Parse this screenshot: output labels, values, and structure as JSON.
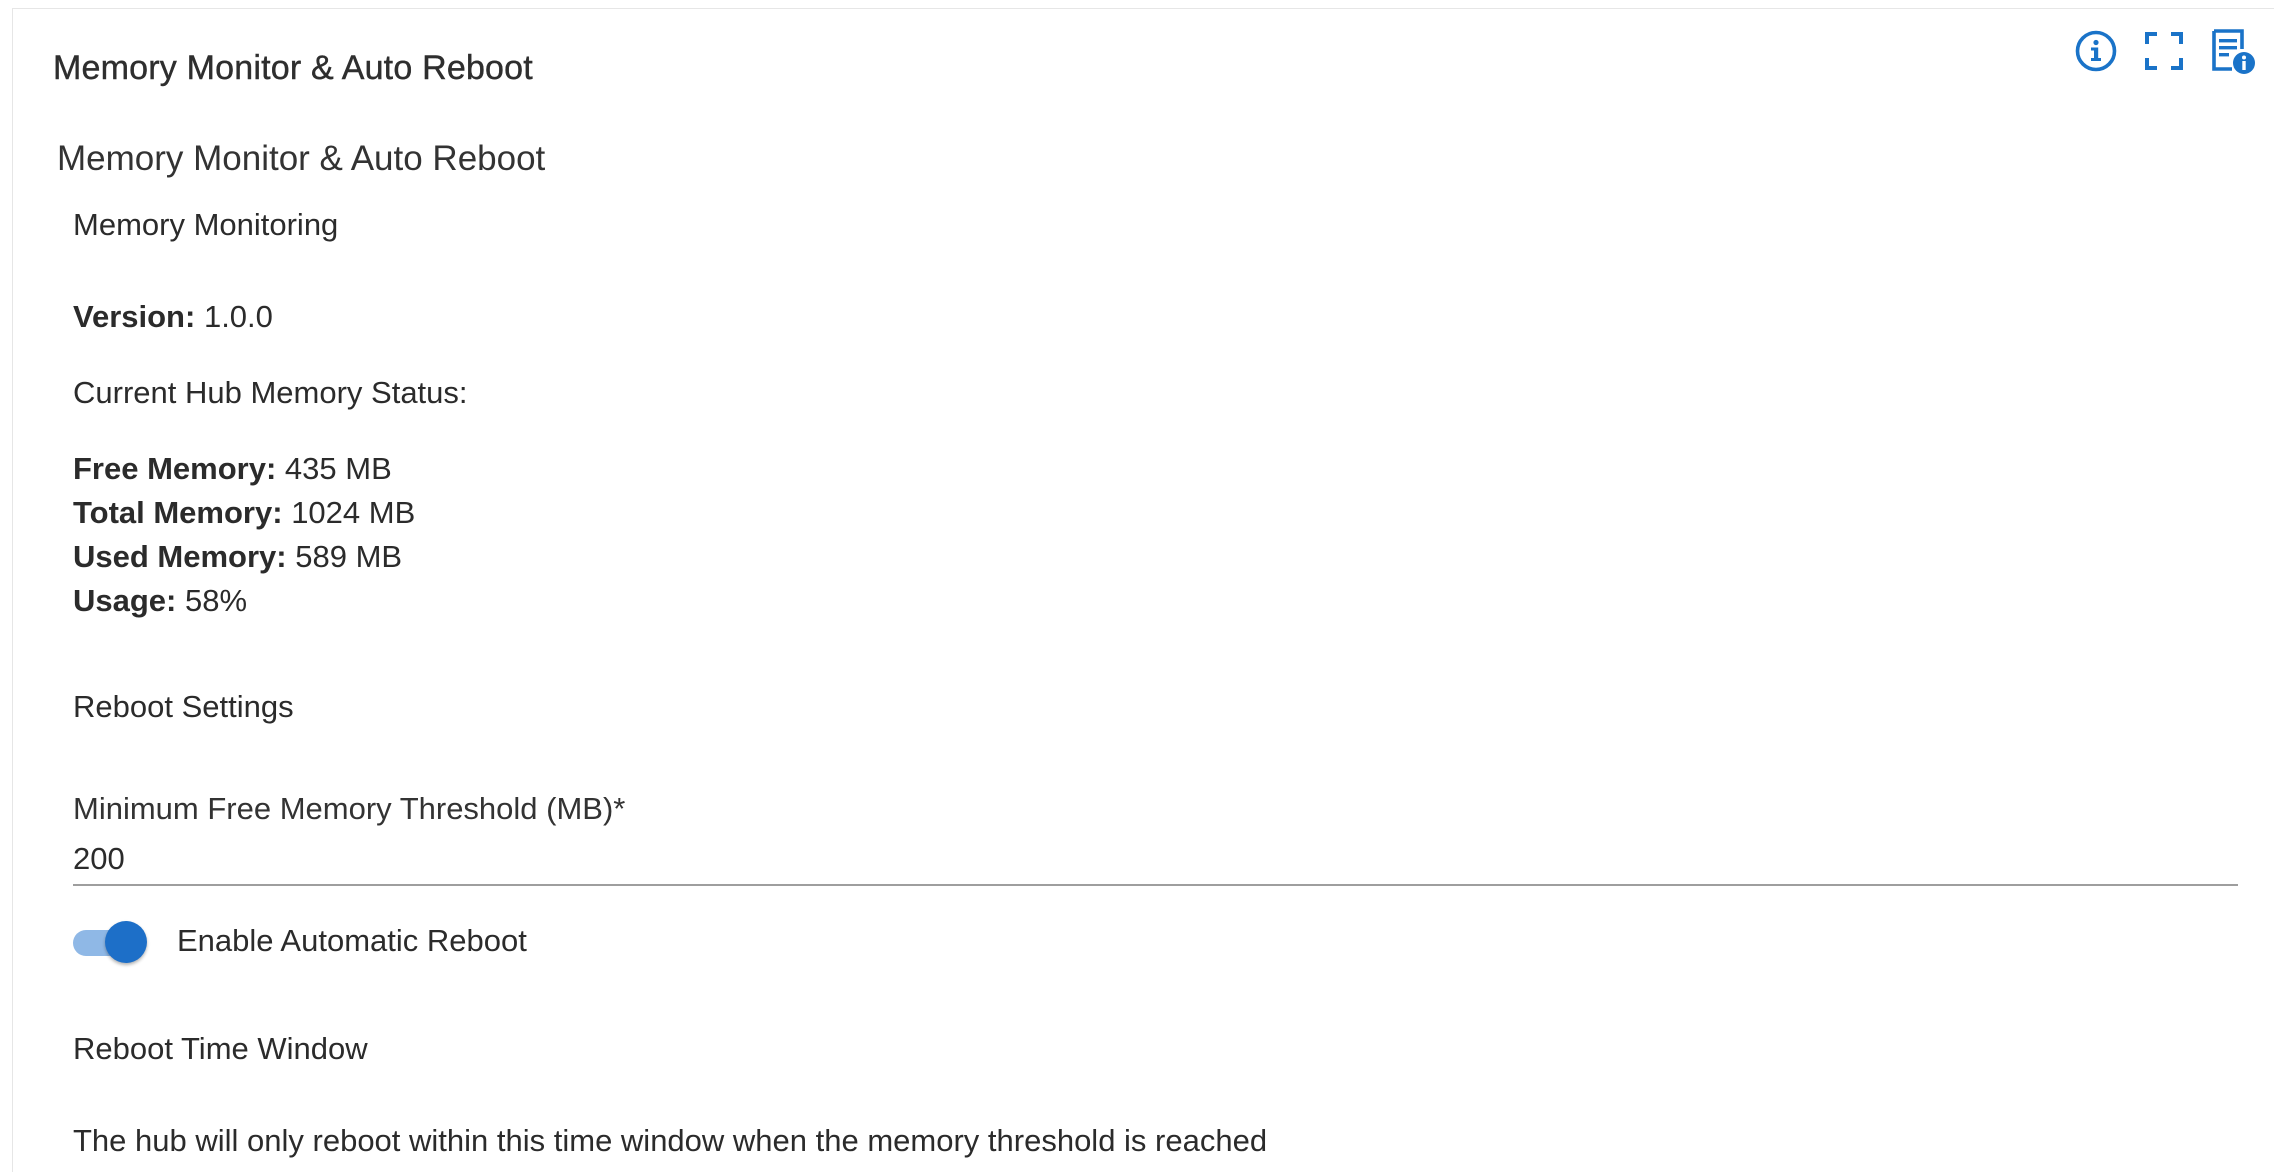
{
  "header": {
    "title": "Memory Monitor & Auto Reboot",
    "icons": [
      "info-icon",
      "fullscreen-icon",
      "app-info-icon"
    ],
    "accent_color": "#1a73c8"
  },
  "main": {
    "section_title": "Memory Monitor & Auto Reboot",
    "monitoring_heading": "Memory Monitoring",
    "version_label": "Version:",
    "version_value": "1.0.0",
    "status_heading": "Current Hub Memory Status:",
    "stats": [
      {
        "label": "Free Memory:",
        "value": "435 MB"
      },
      {
        "label": "Total Memory:",
        "value": "1024 MB"
      },
      {
        "label": "Used Memory:",
        "value": "589 MB"
      },
      {
        "label": "Usage:",
        "value": "58%"
      }
    ],
    "reboot_heading": "Reboot Settings",
    "threshold_label": "Minimum Free Memory Threshold (MB)*",
    "threshold_value": "200",
    "auto_reboot_label": "Enable Automatic Reboot",
    "auto_reboot_enabled": true,
    "time_window_heading": "Reboot Time Window",
    "time_window_description": "The hub will only reboot within this time window when the memory threshold is reached"
  }
}
